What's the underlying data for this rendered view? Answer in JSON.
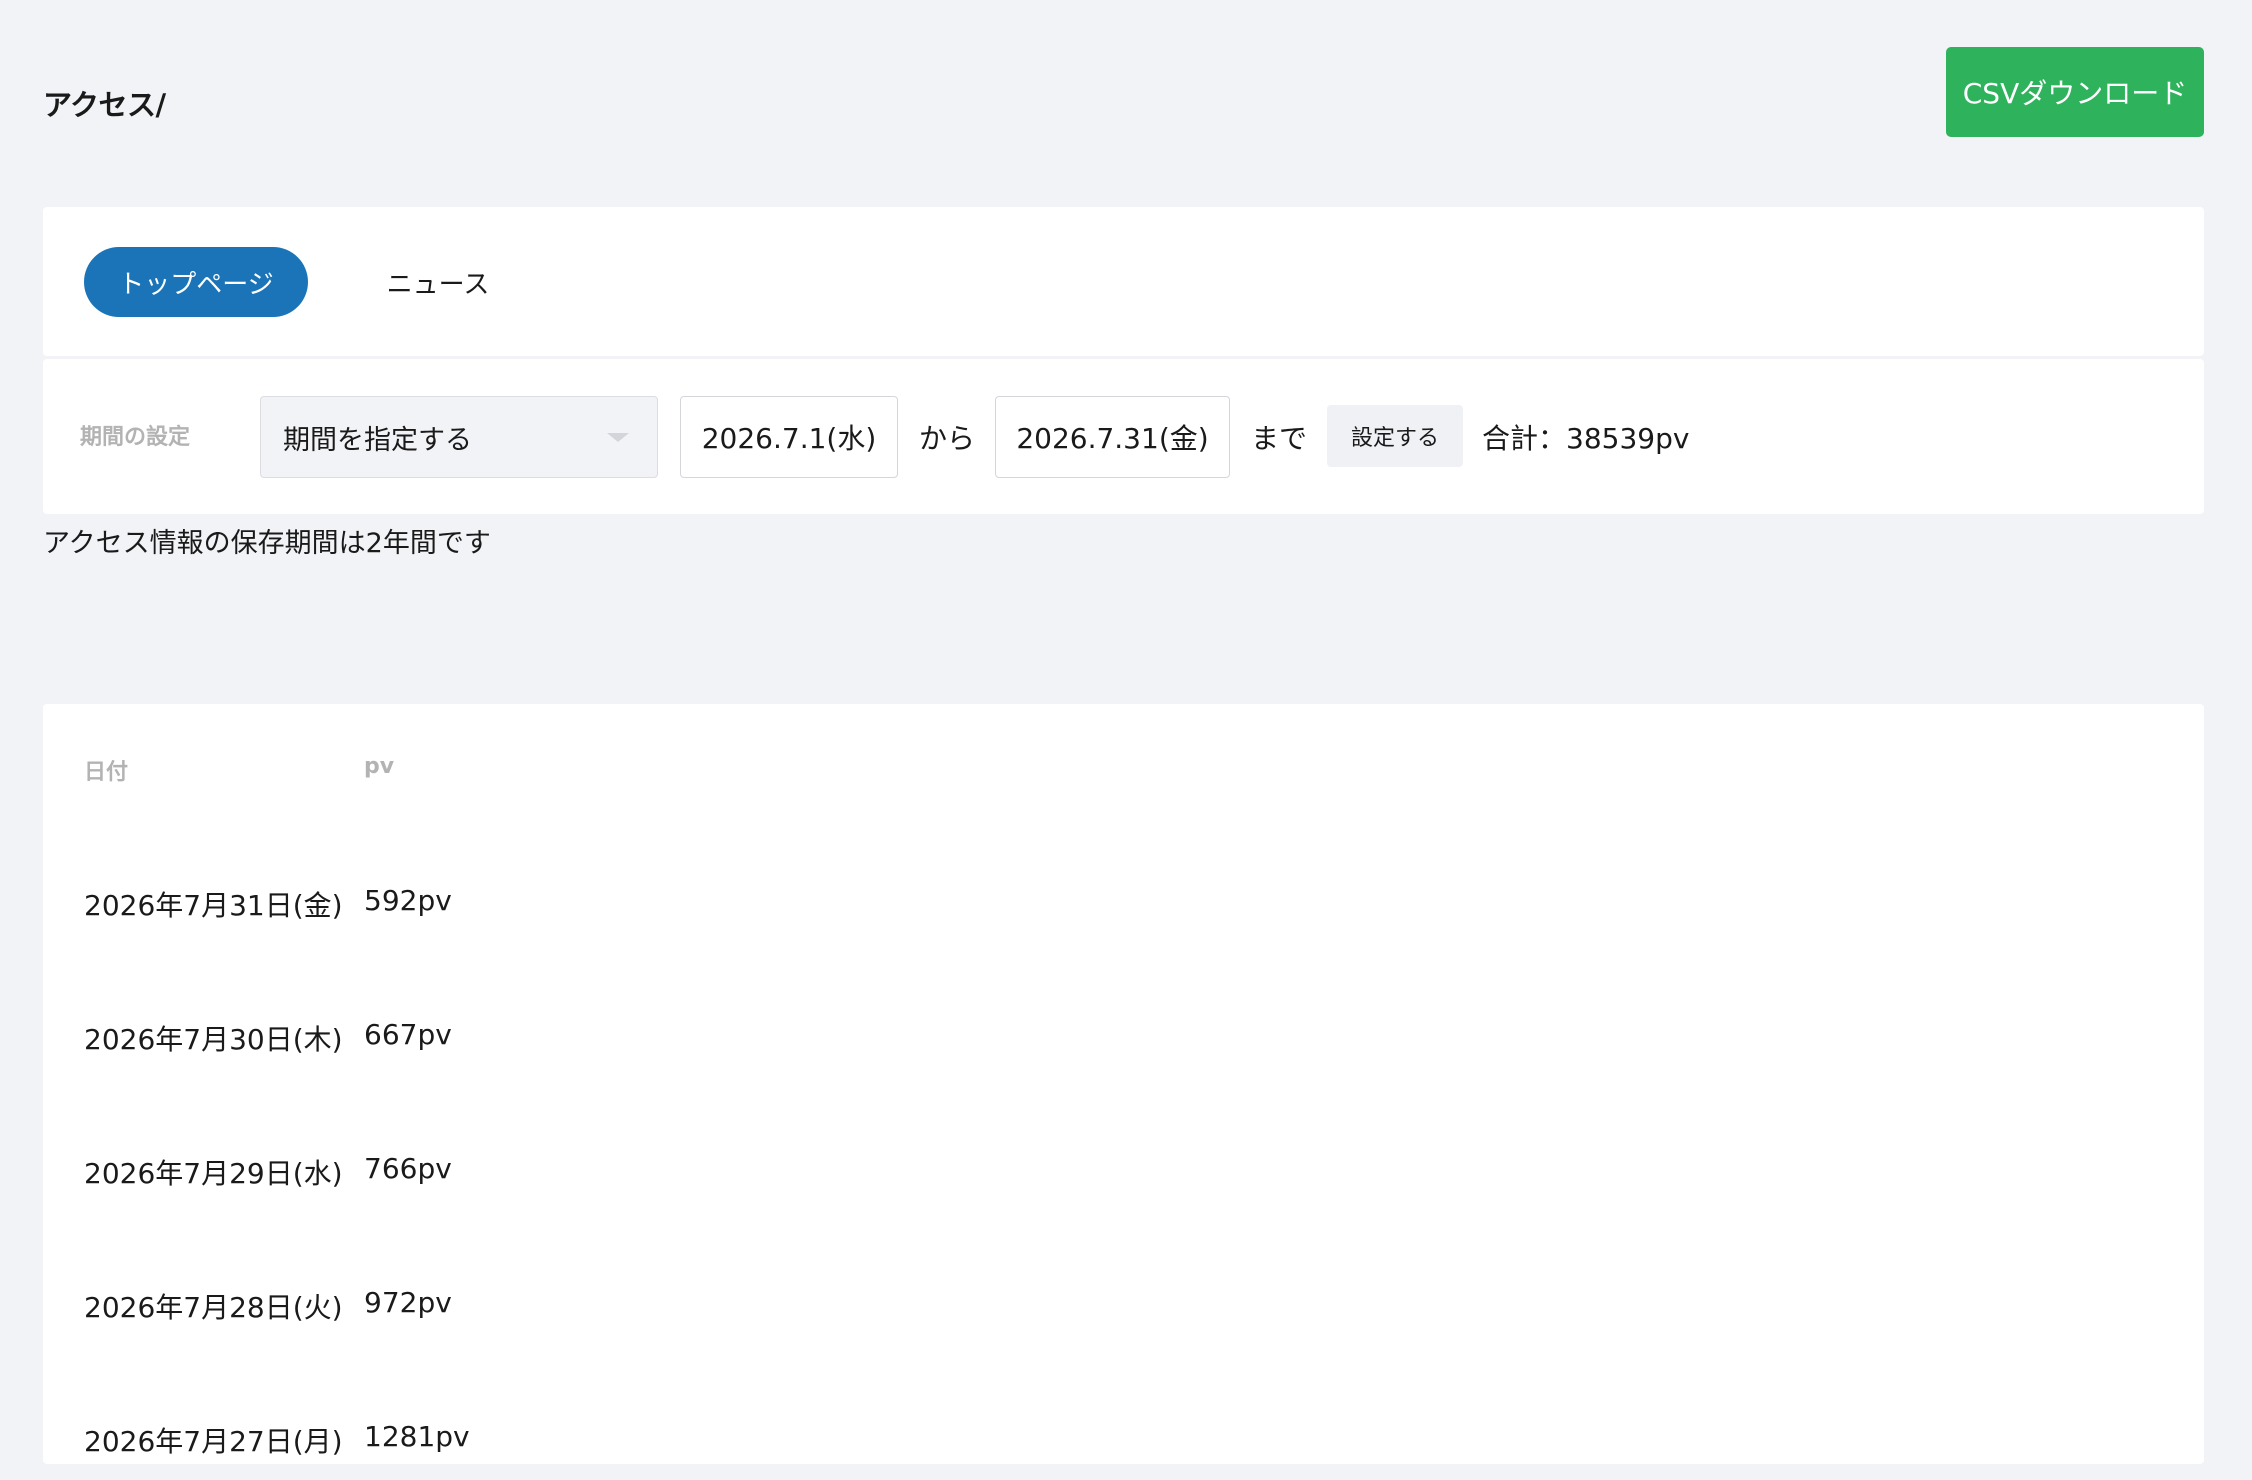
{
  "header": {
    "title": "アクセス/",
    "csv_button_label": "CSVダウンロード"
  },
  "tabs": [
    {
      "label": "トップページ",
      "active": true
    },
    {
      "label": "ニュース",
      "active": false
    }
  ],
  "period": {
    "label": "期間の設定",
    "mode_selected": "期間を指定する",
    "from_date": "2026.7.1(水)",
    "from_text": "から",
    "to_date": "2026.7.31(金)",
    "to_text": "まで",
    "apply_button_label": "設定する",
    "total_text": "合計：38539pv"
  },
  "retention_note": "アクセス情報の保存期間は2年間です",
  "table": {
    "columns": [
      "日付",
      "pv"
    ],
    "rows": [
      {
        "date": "2026年7月31日(金)",
        "pv": "592pv"
      },
      {
        "date": "2026年7月30日(木)",
        "pv": "667pv"
      },
      {
        "date": "2026年7月29日(水)",
        "pv": "766pv"
      },
      {
        "date": "2026年7月28日(火)",
        "pv": "972pv"
      },
      {
        "date": "2026年7月27日(月)",
        "pv": "1281pv"
      }
    ]
  },
  "colors": {
    "background": "#f2f3f6",
    "csv_button": "#2eb35c",
    "active_tab": "#1b74b8",
    "muted_label": "#b3b3b3"
  }
}
